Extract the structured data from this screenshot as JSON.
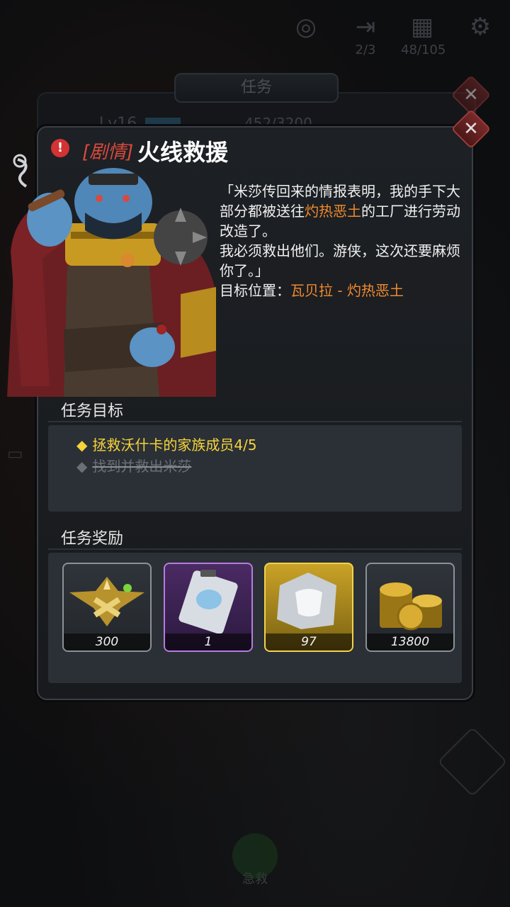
{
  "topbar": {
    "items": [
      {
        "icon": "radar-icon",
        "count": ""
      },
      {
        "icon": "exit-door-icon",
        "count": "2/3"
      },
      {
        "icon": "calendar-icon",
        "count": "48/105"
      },
      {
        "icon": "gear-icon",
        "count": ""
      }
    ]
  },
  "background_panel": {
    "tab_label": "任务",
    "level": "Lv16",
    "xp": "452/3200"
  },
  "quest": {
    "tag": "[剧情]",
    "name": "火线救援",
    "desc_line1_a": "「米莎传回来的情报表明，我的手下大部分都被送往",
    "desc_line1_hl": "灼热恶土",
    "desc_line1_b": "的工厂进行劳动改造了。",
    "desc_line2": "我必须救出他们。游侠，这次还要麻烦你了。」",
    "location_label": "目标位置：",
    "location_value": "瓦贝拉 - 灼热恶土"
  },
  "objectives": {
    "title": "任务目标",
    "items": [
      {
        "text": "拯救沃什卡的家族成员4/5",
        "done": false
      },
      {
        "text": "找到并救出米莎",
        "done": true
      }
    ]
  },
  "rewards": {
    "title": "任务奖励",
    "items": [
      {
        "icon": "rank-badge-icon",
        "qty": "300",
        "rarity": "normal"
      },
      {
        "icon": "blueprint-card-icon",
        "qty": "1",
        "rarity": "purple"
      },
      {
        "icon": "armor-puzzle-piece-icon",
        "qty": "97",
        "rarity": "gold"
      },
      {
        "icon": "gold-coins-icon",
        "qty": "13800",
        "rarity": "normal"
      }
    ]
  },
  "bottom": {
    "label": "急救"
  },
  "colors": {
    "highlight": "#ef8a2e",
    "tag": "#d94a3d",
    "objective_active": "#f5d33a",
    "close": "#7a2a2a"
  }
}
